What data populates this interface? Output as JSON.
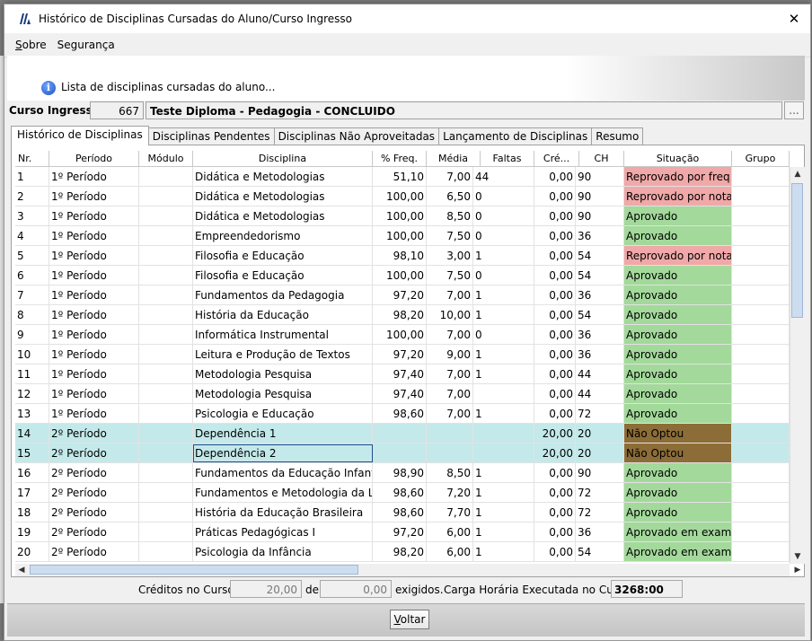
{
  "window": {
    "title": "Histórico de Disciplinas Cursadas do Aluno/Curso Ingresso",
    "close_glyph": "✕"
  },
  "menu": {
    "items": [
      {
        "label": "Sobre",
        "accel": "S",
        "rest": "obre"
      },
      {
        "label": "Segurança",
        "accel": "",
        "rest": "Segurança"
      }
    ]
  },
  "banner": {
    "icon": "info-icon",
    "icon_glyph": "i",
    "text": "Lista de disciplinas cursadas do aluno..."
  },
  "curso": {
    "label": "Curso Ingresso:",
    "code": "667",
    "name": "Teste Diploma - Pedagogia - CONCLUIDO",
    "lookup_label": "..."
  },
  "tabs": [
    "Histórico de Disciplinas",
    "Disciplinas Pendentes",
    "Disciplinas Não Aproveitadas",
    "Lançamento de Disciplinas",
    "Resumo"
  ],
  "grid": {
    "columns": [
      "Nr.",
      "Período",
      "Módulo",
      "Disciplina",
      "% Freq.",
      "Média",
      "Faltas",
      "Cré...",
      "CH",
      "Situação",
      "Grupo"
    ],
    "rows": [
      {
        "nr": "1",
        "periodo": "1º Período",
        "modulo": "",
        "disciplina": "Didática e Metodologias",
        "freq": "51,10",
        "media": "7,00",
        "faltas": "44",
        "cred": "0,00",
        "ch": "90",
        "situacao": "Reprovado por freq...",
        "status": "red"
      },
      {
        "nr": "2",
        "periodo": "1º Período",
        "modulo": "",
        "disciplina": "Didática e Metodologias",
        "freq": "100,00",
        "media": "6,50",
        "faltas": "0",
        "cred": "0,00",
        "ch": "90",
        "situacao": "Reprovado por nota",
        "status": "red"
      },
      {
        "nr": "3",
        "periodo": "1º Período",
        "modulo": "",
        "disciplina": "Didática e Metodologias",
        "freq": "100,00",
        "media": "8,50",
        "faltas": "0",
        "cred": "0,00",
        "ch": "90",
        "situacao": "Aprovado",
        "status": "green"
      },
      {
        "nr": "4",
        "periodo": "1º Período",
        "modulo": "",
        "disciplina": "Empreendedorismo",
        "freq": "100,00",
        "media": "7,50",
        "faltas": "0",
        "cred": "0,00",
        "ch": "36",
        "situacao": "Aprovado",
        "status": "green"
      },
      {
        "nr": "5",
        "periodo": "1º Período",
        "modulo": "",
        "disciplina": "Filosofia e Educação",
        "freq": "98,10",
        "media": "3,00",
        "faltas": "1",
        "cred": "0,00",
        "ch": "54",
        "situacao": "Reprovado por nota",
        "status": "red"
      },
      {
        "nr": "6",
        "periodo": "1º Período",
        "modulo": "",
        "disciplina": "Filosofia e Educação",
        "freq": "100,00",
        "media": "7,50",
        "faltas": "0",
        "cred": "0,00",
        "ch": "54",
        "situacao": "Aprovado",
        "status": "green"
      },
      {
        "nr": "7",
        "periodo": "1º Período",
        "modulo": "",
        "disciplina": "Fundamentos da Pedagogia",
        "freq": "97,20",
        "media": "7,00",
        "faltas": "1",
        "cred": "0,00",
        "ch": "36",
        "situacao": "Aprovado",
        "status": "green"
      },
      {
        "nr": "8",
        "periodo": "1º Período",
        "modulo": "",
        "disciplina": "História da Educação",
        "freq": "98,20",
        "media": "10,00",
        "faltas": "1",
        "cred": "0,00",
        "ch": "54",
        "situacao": "Aprovado",
        "status": "green"
      },
      {
        "nr": "9",
        "periodo": "1º Período",
        "modulo": "",
        "disciplina": "Informática Instrumental",
        "freq": "100,00",
        "media": "7,00",
        "faltas": "0",
        "cred": "0,00",
        "ch": "36",
        "situacao": "Aprovado",
        "status": "green"
      },
      {
        "nr": "10",
        "periodo": "1º Período",
        "modulo": "",
        "disciplina": "Leitura e Produção de Textos",
        "freq": "97,20",
        "media": "9,00",
        "faltas": "1",
        "cred": "0,00",
        "ch": "36",
        "situacao": "Aprovado",
        "status": "green"
      },
      {
        "nr": "11",
        "periodo": "1º Período",
        "modulo": "",
        "disciplina": "Metodologia Pesquisa",
        "freq": "97,40",
        "media": "7,00",
        "faltas": "1",
        "cred": "0,00",
        "ch": "44",
        "situacao": "Aprovado",
        "status": "green"
      },
      {
        "nr": "12",
        "periodo": "1º Período",
        "modulo": "",
        "disciplina": "Metodologia Pesquisa",
        "freq": "97,40",
        "media": "7,00",
        "faltas": "",
        "cred": "0,00",
        "ch": "44",
        "situacao": "Aprovado",
        "status": "green"
      },
      {
        "nr": "13",
        "periodo": "1º Período",
        "modulo": "",
        "disciplina": "Psicologia e Educação",
        "freq": "98,60",
        "media": "7,00",
        "faltas": "1",
        "cred": "0,00",
        "ch": "72",
        "situacao": "Aprovado",
        "status": "green"
      },
      {
        "nr": "14",
        "periodo": "2º Período",
        "modulo": "",
        "disciplina": "Dependência 1",
        "freq": "",
        "media": "",
        "faltas": "",
        "cred": "20,00",
        "ch": "20",
        "situacao": "Não Optou",
        "status": "brown",
        "selected": true
      },
      {
        "nr": "15",
        "periodo": "2º Período",
        "modulo": "",
        "disciplina": "Dependência 2",
        "freq": "",
        "media": "",
        "faltas": "",
        "cred": "20,00",
        "ch": "20",
        "situacao": "Não Optou",
        "status": "brown",
        "selected": true,
        "focused": true
      },
      {
        "nr": "16",
        "periodo": "2º Período",
        "modulo": "",
        "disciplina": "Fundamentos da Educação Infantil ...",
        "freq": "98,90",
        "media": "8,50",
        "faltas": "1",
        "cred": "0,00",
        "ch": "90",
        "situacao": "Aprovado",
        "status": "green"
      },
      {
        "nr": "17",
        "periodo": "2º Período",
        "modulo": "",
        "disciplina": "Fundamentos e Metodologia da Lin...",
        "freq": "98,60",
        "media": "7,20",
        "faltas": "1",
        "cred": "0,00",
        "ch": "72",
        "situacao": "Aprovado",
        "status": "green"
      },
      {
        "nr": "18",
        "periodo": "2º Período",
        "modulo": "",
        "disciplina": "História da Educação Brasileira",
        "freq": "98,60",
        "media": "7,70",
        "faltas": "1",
        "cred": "0,00",
        "ch": "72",
        "situacao": "Aprovado",
        "status": "green"
      },
      {
        "nr": "19",
        "periodo": "2º Período",
        "modulo": "",
        "disciplina": "Práticas Pedagógicas I",
        "freq": "97,20",
        "media": "6,00",
        "faltas": "1",
        "cred": "0,00",
        "ch": "36",
        "situacao": "Aprovado em exame",
        "status": "green"
      },
      {
        "nr": "20",
        "periodo": "2º Período",
        "modulo": "",
        "disciplina": "Psicologia da Infância",
        "freq": "98,20",
        "media": "6,00",
        "faltas": "1",
        "cred": "0,00",
        "ch": "54",
        "situacao": "Aprovado em exame",
        "status": "green"
      }
    ]
  },
  "footer": {
    "creditos_label": "Créditos no Curso:",
    "creditos_value": "20,00",
    "de_label": "de",
    "exigidos_value": "0,00",
    "exigidos_label": "exigidos.",
    "carga_label": "Carga Horária Executada no Curso:",
    "carga_value": "3268:00"
  },
  "buttons": {
    "voltar_accel": "V",
    "voltar_rest": "oltar"
  },
  "colors": {
    "approved": "#a3d99b",
    "failed": "#f0a8a8",
    "not_opted": "#8c6c37",
    "selected_row": "#c4e9ea"
  }
}
